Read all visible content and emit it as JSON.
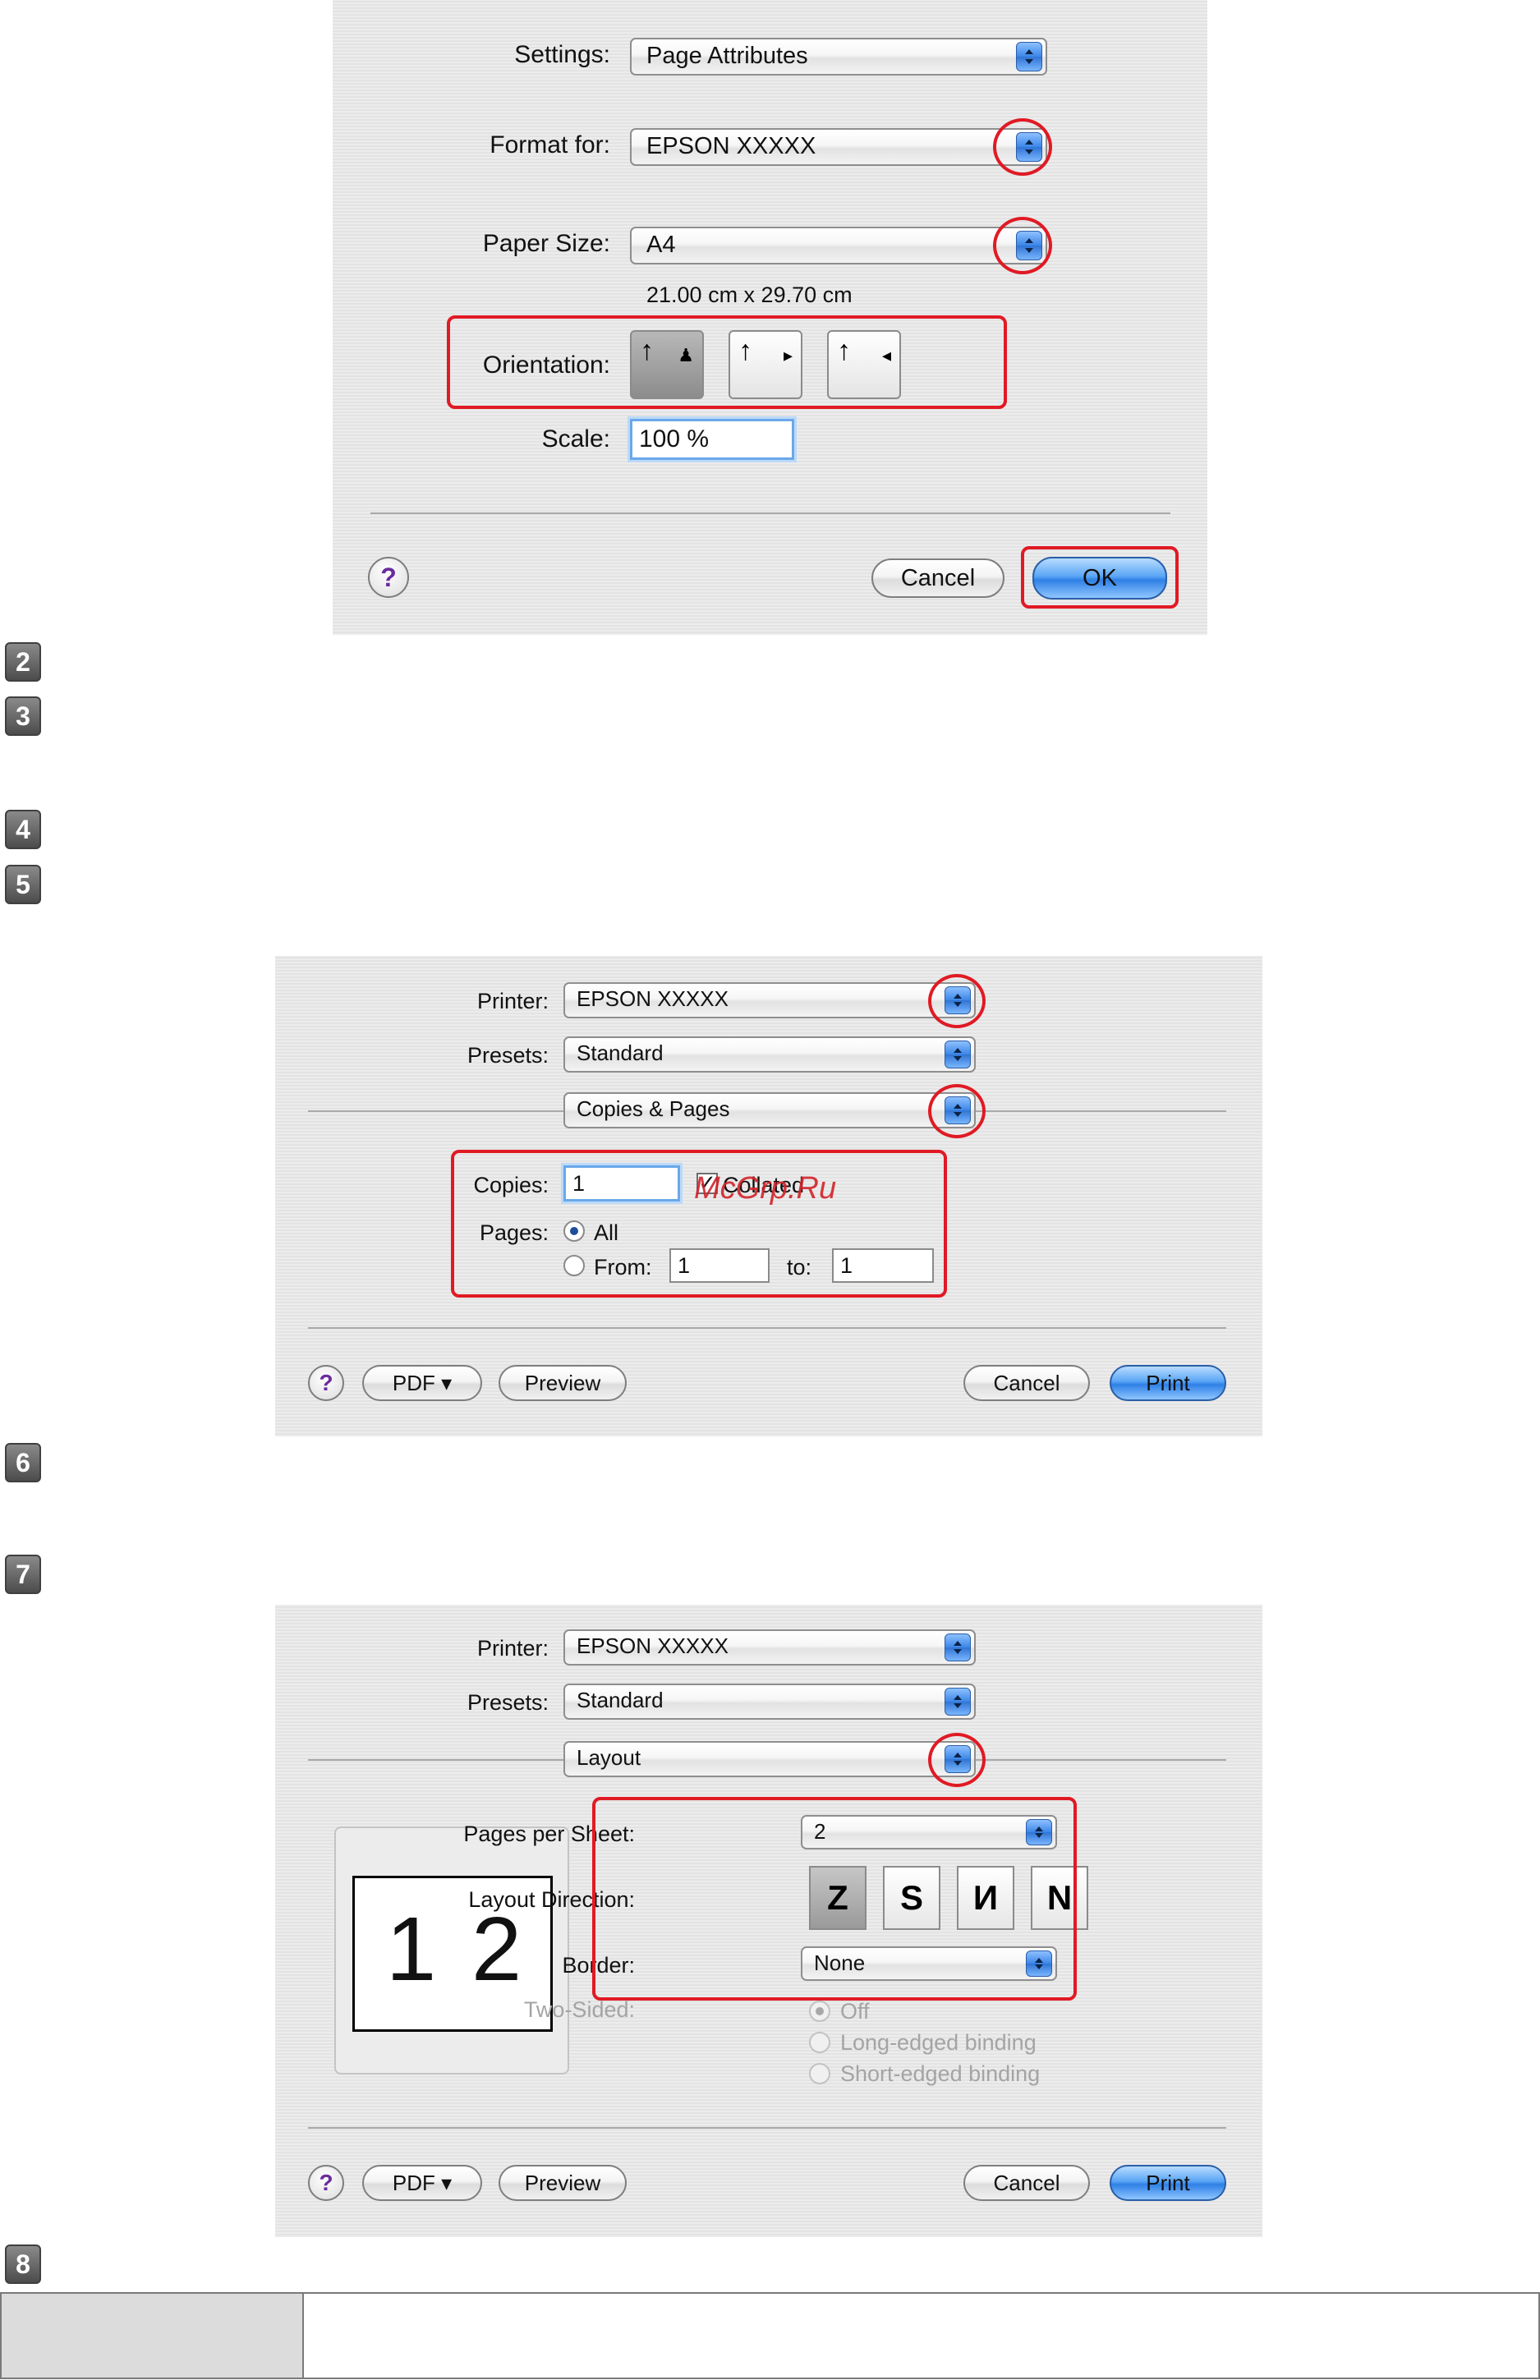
{
  "page_setup": {
    "settings_label": "Settings:",
    "settings_value": "Page Attributes",
    "format_label": "Format for:",
    "format_value": "EPSON XXXXX",
    "paper_label": "Paper Size:",
    "paper_value": "A4",
    "paper_dimensions": "21.00 cm x 29.70 cm",
    "orientation_label": "Orientation:",
    "orientation_selected": "portrait",
    "scale_label": "Scale:",
    "scale_value": "100 %",
    "help": "?",
    "cancel": "Cancel",
    "ok": "OK"
  },
  "steps": [
    "2",
    "3",
    "4",
    "5",
    "6",
    "7",
    "8"
  ],
  "print_copies": {
    "printer_label": "Printer:",
    "printer_value": "EPSON XXXXX",
    "presets_label": "Presets:",
    "presets_value": "Standard",
    "pane_value": "Copies & Pages",
    "copies_label": "Copies:",
    "copies_value": "1",
    "collated_label": "Collated",
    "collated_checked": true,
    "watermark": "McGrp.Ru",
    "pages_label": "Pages:",
    "all_label": "All",
    "from_label": "From:",
    "from_value": "1",
    "to_label": "to:",
    "to_value": "1",
    "help": "?",
    "pdf": "PDF ▾",
    "preview": "Preview",
    "cancel": "Cancel",
    "print": "Print"
  },
  "print_layout": {
    "printer_label": "Printer:",
    "printer_value": "EPSON XXXXX",
    "presets_label": "Presets:",
    "presets_value": "Standard",
    "pane_value": "Layout",
    "preview_page_1": "1",
    "preview_page_2": "2",
    "pages_per_sheet_label": "Pages per Sheet:",
    "pages_per_sheet_value": "2",
    "layout_direction_label": "Layout Direction:",
    "layout_directions": [
      "Z",
      "S",
      "И",
      "N"
    ],
    "border_label": "Border:",
    "border_value": "None",
    "two_sided_label": "Two-Sided:",
    "two_sided_off": "Off",
    "two_sided_long": "Long-edged binding",
    "two_sided_short": "Short-edged binding",
    "help": "?",
    "pdf": "PDF ▾",
    "preview": "Preview",
    "cancel": "Cancel",
    "print": "Print"
  },
  "table": {
    "header_cell": "",
    "body_cell": ""
  }
}
